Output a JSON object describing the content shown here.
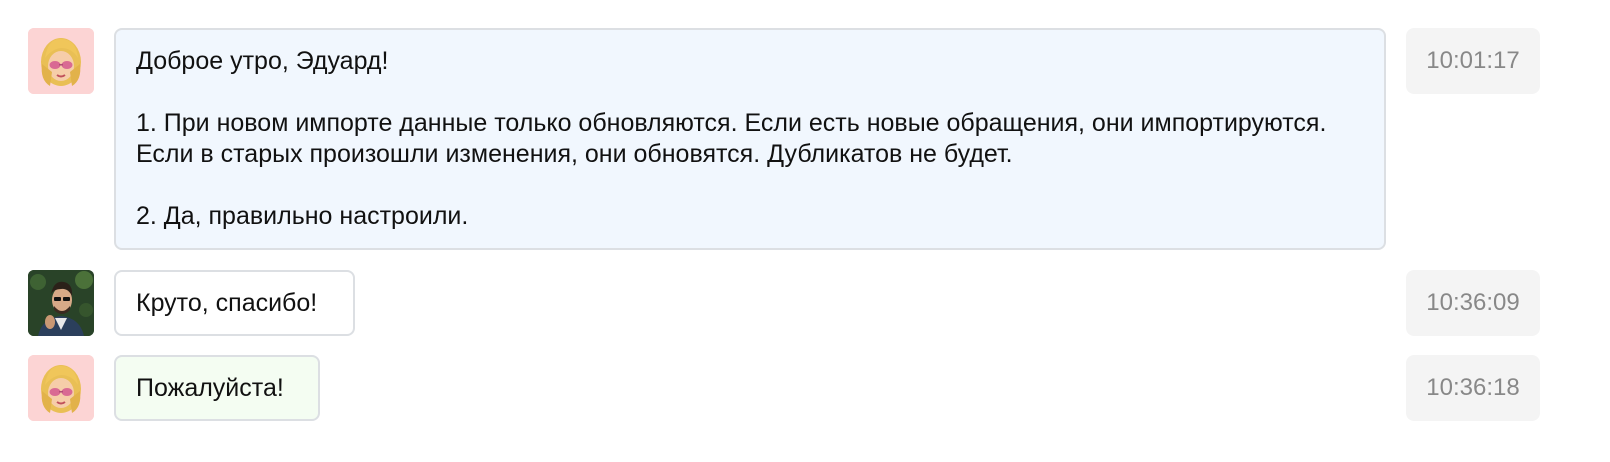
{
  "messages": [
    {
      "author": "support-agent",
      "avatar_icon": "woman-emoji-avatar-icon",
      "text": "Доброе утро, Эдуард!\n\n1. При новом импорте данные только обновляются. Если есть новые обращения, они импортируются. Если в старых произошли изменения, они обновятся. Дубликатов не будет.\n\n2. Да, правильно настроили.",
      "time": "10:01:17",
      "bubble_color": "#f1f7fe"
    },
    {
      "author": "client",
      "avatar_icon": "man-photo-avatar-icon",
      "text": "Круто, спасибо!",
      "time": "10:36:09",
      "bubble_color": "#ffffff"
    },
    {
      "author": "support-agent",
      "avatar_icon": "woman-emoji-avatar-icon",
      "text": "Пожалуйста!",
      "time": "10:36:18",
      "bubble_color": "#f4fdf2"
    }
  ]
}
